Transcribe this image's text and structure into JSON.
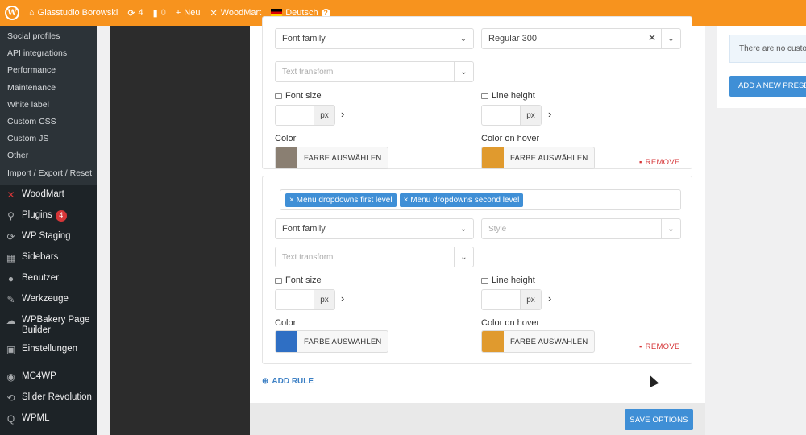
{
  "adminbar": {
    "site_name": "Glasstudio Borowski",
    "updates_count": "4",
    "comments_count": "0",
    "new_label": "Neu",
    "theme_label": "WoodMart",
    "language_label": "Deutsch"
  },
  "sidebar": {
    "submenu": [
      "Social profiles",
      "API integrations",
      "Performance",
      "Maintenance",
      "White label",
      "Custom CSS",
      "Custom JS",
      "Other",
      "Import / Export / Reset"
    ],
    "items": [
      {
        "label": "WoodMart",
        "icon": "woodmart-icon"
      },
      {
        "label": "Plugins",
        "icon": "plugin-icon",
        "badge": "4"
      },
      {
        "label": "WP Staging",
        "icon": "refresh-icon"
      },
      {
        "label": "Sidebars",
        "icon": "table-icon"
      },
      {
        "label": "Benutzer",
        "icon": "user-icon"
      },
      {
        "label": "Werkzeuge",
        "icon": "wrench-icon"
      },
      {
        "label": "WPBakery Page Builder",
        "icon": "cloud-icon"
      },
      {
        "label": "Einstellungen",
        "icon": "settings-icon"
      },
      {
        "label": "MC4WP",
        "icon": "mailchimp-icon"
      },
      {
        "label": "Slider Revolution",
        "icon": "slider-icon"
      },
      {
        "label": "WPML",
        "icon": "wpml-icon"
      }
    ]
  },
  "rule1": {
    "font_family_value": "Font family",
    "font_weight_value": "Regular 300",
    "text_transform_placeholder": "Text transform",
    "font_size_label": "Font size",
    "line_height_label": "Line height",
    "unit": "px",
    "color_label": "Color",
    "color_hover_label": "Color on hover",
    "color_button": "FARBE AUSWÄHLEN",
    "color_swatch": "#8a7f72",
    "hover_swatch": "#e09a2e",
    "remove_label": "REMOVE"
  },
  "rule2": {
    "tags": [
      "Menu dropdowns first level",
      "Menu dropdowns second level"
    ],
    "font_family_value": "Font family",
    "style_placeholder": "Style",
    "text_transform_placeholder": "Text transform",
    "font_size_label": "Font size",
    "line_height_label": "Line height",
    "unit": "px",
    "color_label": "Color",
    "color_hover_label": "Color on hover",
    "color_button": "FARBE AUSWÄHLEN",
    "color_swatch": "#2f6fc4",
    "hover_swatch": "#e09a2e",
    "remove_label": "REMOVE"
  },
  "add_rule_label": "ADD RULE",
  "save_options_label": "SAVE OPTIONS",
  "presets": {
    "notice": "There are no custom",
    "add_button": "ADD A NEW PRESET"
  }
}
